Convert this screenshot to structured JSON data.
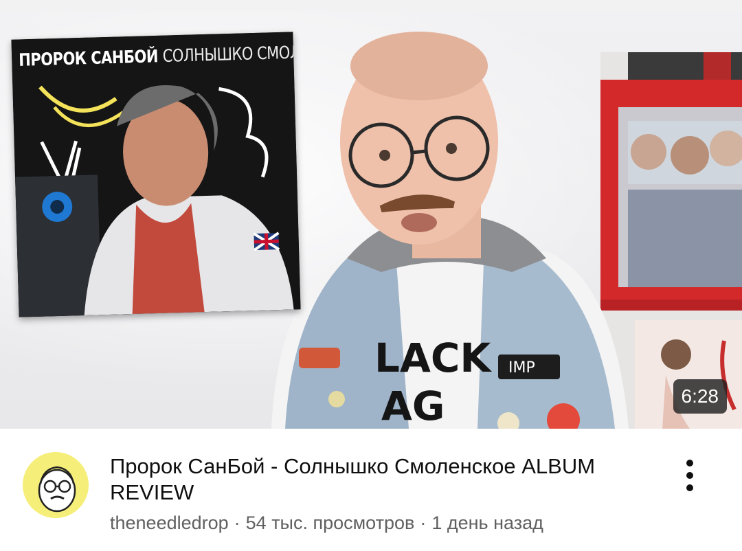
{
  "video": {
    "thumbnail": {
      "poster_title_main": "ПРОРОК САНБОЙ",
      "poster_title_sub": "СОЛНЫШКО СМОЛЕНСКОЕ",
      "duration": "6:28"
    },
    "title": "Пророк СанБой - Солнышко Смоленское ALBUM REVIEW",
    "channel": "theneedledrop",
    "views": "54 тыс. просмотров",
    "age": "1 день назад",
    "separator": "·",
    "more_icon": "vertical-dots-icon"
  },
  "colors": {
    "title": "#0f0f0f",
    "meta": "#606060",
    "avatar_bg": "#f5ef7a",
    "duration_bg": "#222222",
    "shelf_red": "#d3292b"
  }
}
